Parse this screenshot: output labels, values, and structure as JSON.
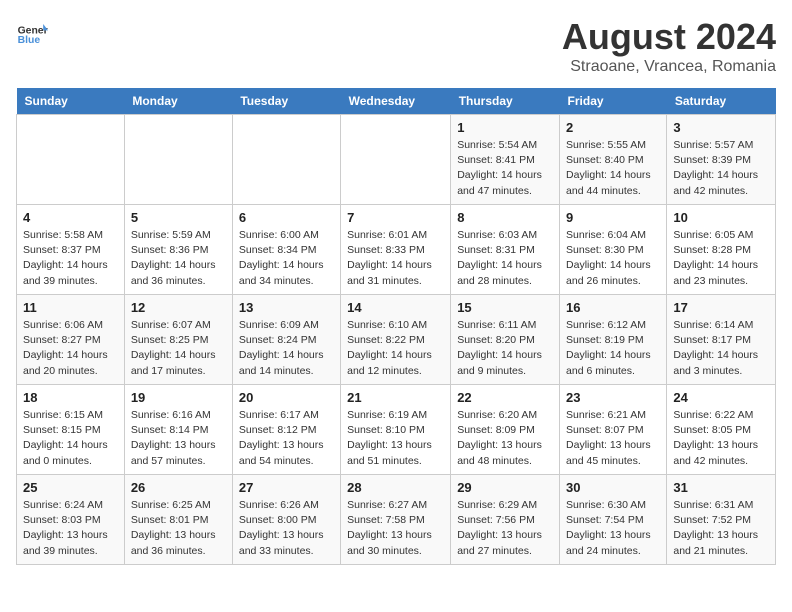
{
  "logo": {
    "line1": "General",
    "line2": "Blue"
  },
  "title": "August 2024",
  "subtitle": "Straoane, Vrancea, Romania",
  "headers": [
    "Sunday",
    "Monday",
    "Tuesday",
    "Wednesday",
    "Thursday",
    "Friday",
    "Saturday"
  ],
  "weeks": [
    [
      {
        "day": "",
        "info": ""
      },
      {
        "day": "",
        "info": ""
      },
      {
        "day": "",
        "info": ""
      },
      {
        "day": "",
        "info": ""
      },
      {
        "day": "1",
        "info": "Sunrise: 5:54 AM\nSunset: 8:41 PM\nDaylight: 14 hours and 47 minutes."
      },
      {
        "day": "2",
        "info": "Sunrise: 5:55 AM\nSunset: 8:40 PM\nDaylight: 14 hours and 44 minutes."
      },
      {
        "day": "3",
        "info": "Sunrise: 5:57 AM\nSunset: 8:39 PM\nDaylight: 14 hours and 42 minutes."
      }
    ],
    [
      {
        "day": "4",
        "info": "Sunrise: 5:58 AM\nSunset: 8:37 PM\nDaylight: 14 hours and 39 minutes."
      },
      {
        "day": "5",
        "info": "Sunrise: 5:59 AM\nSunset: 8:36 PM\nDaylight: 14 hours and 36 minutes."
      },
      {
        "day": "6",
        "info": "Sunrise: 6:00 AM\nSunset: 8:34 PM\nDaylight: 14 hours and 34 minutes."
      },
      {
        "day": "7",
        "info": "Sunrise: 6:01 AM\nSunset: 8:33 PM\nDaylight: 14 hours and 31 minutes."
      },
      {
        "day": "8",
        "info": "Sunrise: 6:03 AM\nSunset: 8:31 PM\nDaylight: 14 hours and 28 minutes."
      },
      {
        "day": "9",
        "info": "Sunrise: 6:04 AM\nSunset: 8:30 PM\nDaylight: 14 hours and 26 minutes."
      },
      {
        "day": "10",
        "info": "Sunrise: 6:05 AM\nSunset: 8:28 PM\nDaylight: 14 hours and 23 minutes."
      }
    ],
    [
      {
        "day": "11",
        "info": "Sunrise: 6:06 AM\nSunset: 8:27 PM\nDaylight: 14 hours and 20 minutes."
      },
      {
        "day": "12",
        "info": "Sunrise: 6:07 AM\nSunset: 8:25 PM\nDaylight: 14 hours and 17 minutes."
      },
      {
        "day": "13",
        "info": "Sunrise: 6:09 AM\nSunset: 8:24 PM\nDaylight: 14 hours and 14 minutes."
      },
      {
        "day": "14",
        "info": "Sunrise: 6:10 AM\nSunset: 8:22 PM\nDaylight: 14 hours and 12 minutes."
      },
      {
        "day": "15",
        "info": "Sunrise: 6:11 AM\nSunset: 8:20 PM\nDaylight: 14 hours and 9 minutes."
      },
      {
        "day": "16",
        "info": "Sunrise: 6:12 AM\nSunset: 8:19 PM\nDaylight: 14 hours and 6 minutes."
      },
      {
        "day": "17",
        "info": "Sunrise: 6:14 AM\nSunset: 8:17 PM\nDaylight: 14 hours and 3 minutes."
      }
    ],
    [
      {
        "day": "18",
        "info": "Sunrise: 6:15 AM\nSunset: 8:15 PM\nDaylight: 14 hours and 0 minutes."
      },
      {
        "day": "19",
        "info": "Sunrise: 6:16 AM\nSunset: 8:14 PM\nDaylight: 13 hours and 57 minutes."
      },
      {
        "day": "20",
        "info": "Sunrise: 6:17 AM\nSunset: 8:12 PM\nDaylight: 13 hours and 54 minutes."
      },
      {
        "day": "21",
        "info": "Sunrise: 6:19 AM\nSunset: 8:10 PM\nDaylight: 13 hours and 51 minutes."
      },
      {
        "day": "22",
        "info": "Sunrise: 6:20 AM\nSunset: 8:09 PM\nDaylight: 13 hours and 48 minutes."
      },
      {
        "day": "23",
        "info": "Sunrise: 6:21 AM\nSunset: 8:07 PM\nDaylight: 13 hours and 45 minutes."
      },
      {
        "day": "24",
        "info": "Sunrise: 6:22 AM\nSunset: 8:05 PM\nDaylight: 13 hours and 42 minutes."
      }
    ],
    [
      {
        "day": "25",
        "info": "Sunrise: 6:24 AM\nSunset: 8:03 PM\nDaylight: 13 hours and 39 minutes."
      },
      {
        "day": "26",
        "info": "Sunrise: 6:25 AM\nSunset: 8:01 PM\nDaylight: 13 hours and 36 minutes."
      },
      {
        "day": "27",
        "info": "Sunrise: 6:26 AM\nSunset: 8:00 PM\nDaylight: 13 hours and 33 minutes."
      },
      {
        "day": "28",
        "info": "Sunrise: 6:27 AM\nSunset: 7:58 PM\nDaylight: 13 hours and 30 minutes."
      },
      {
        "day": "29",
        "info": "Sunrise: 6:29 AM\nSunset: 7:56 PM\nDaylight: 13 hours and 27 minutes."
      },
      {
        "day": "30",
        "info": "Sunrise: 6:30 AM\nSunset: 7:54 PM\nDaylight: 13 hours and 24 minutes."
      },
      {
        "day": "31",
        "info": "Sunrise: 6:31 AM\nSunset: 7:52 PM\nDaylight: 13 hours and 21 minutes."
      }
    ]
  ]
}
